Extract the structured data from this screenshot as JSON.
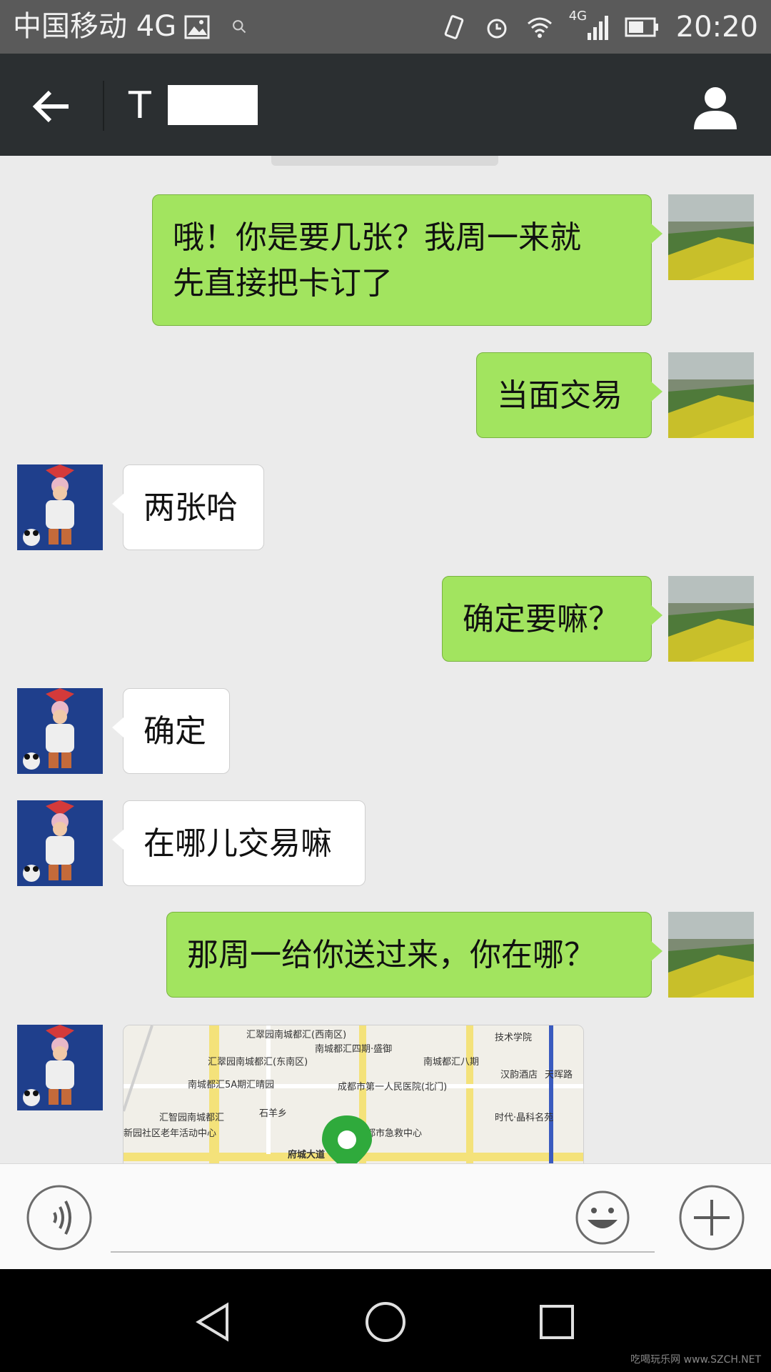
{
  "status_bar": {
    "carrier": "中国移动 4G",
    "network": "4G",
    "time": "20:20",
    "icons": [
      "image-icon",
      "search-icon",
      "vibrate-icon",
      "alarm-icon",
      "wifi-icon",
      "signal-icon",
      "battery-icon"
    ]
  },
  "header": {
    "title": "T",
    "back_icon": "arrow-left-icon",
    "contact_icon": "person-icon",
    "background": "#2b2f31"
  },
  "messages": [
    {
      "side": "out",
      "text_lines": [
        "哦！你是要几张？我周一来就",
        "先直接把卡订了"
      ]
    },
    {
      "side": "out",
      "text_lines": [
        "当面交易"
      ]
    },
    {
      "side": "in",
      "text_lines": [
        "两张哈"
      ]
    },
    {
      "side": "out",
      "text_lines": [
        "确定要嘛？"
      ]
    },
    {
      "side": "in",
      "text_lines": [
        "确定"
      ]
    },
    {
      "side": "in",
      "text_lines": [
        "在哪儿交易嘛"
      ]
    },
    {
      "side": "out",
      "text_lines": [
        "那周一给你送过来，你在哪？"
      ]
    },
    {
      "side": "in",
      "type": "location",
      "map_labels": [
        "汇翠园南城都汇(西南区)",
        "南城都汇四期·盛御",
        "南城都汇八期",
        "汉韵酒店",
        "技术学院",
        "汇翠园南城都汇(东南区)",
        "南城都汇5A期汇晴园",
        "成都市第一人民医院(北门)",
        "天晖路",
        "石羊乡",
        "汇智园南城都汇",
        "时代·晶科名苑",
        "府城大道",
        "新园社区老年活动中心",
        "都市急救中心"
      ]
    }
  ],
  "input_bar": {
    "voice_icon": "voice-icon",
    "text_value": "",
    "emoji_icon": "emoji-icon",
    "plus_icon": "plus-icon"
  },
  "nav_bar": {
    "icons": [
      "back-triangle-icon",
      "home-circle-icon",
      "recents-square-icon"
    ]
  },
  "watermark": "吃喝玩乐网 www.SZCH.NET",
  "colors": {
    "outgoing_bubble": "#a2e45f",
    "incoming_bubble": "#ffffff",
    "chat_background": "#ebebeb"
  }
}
